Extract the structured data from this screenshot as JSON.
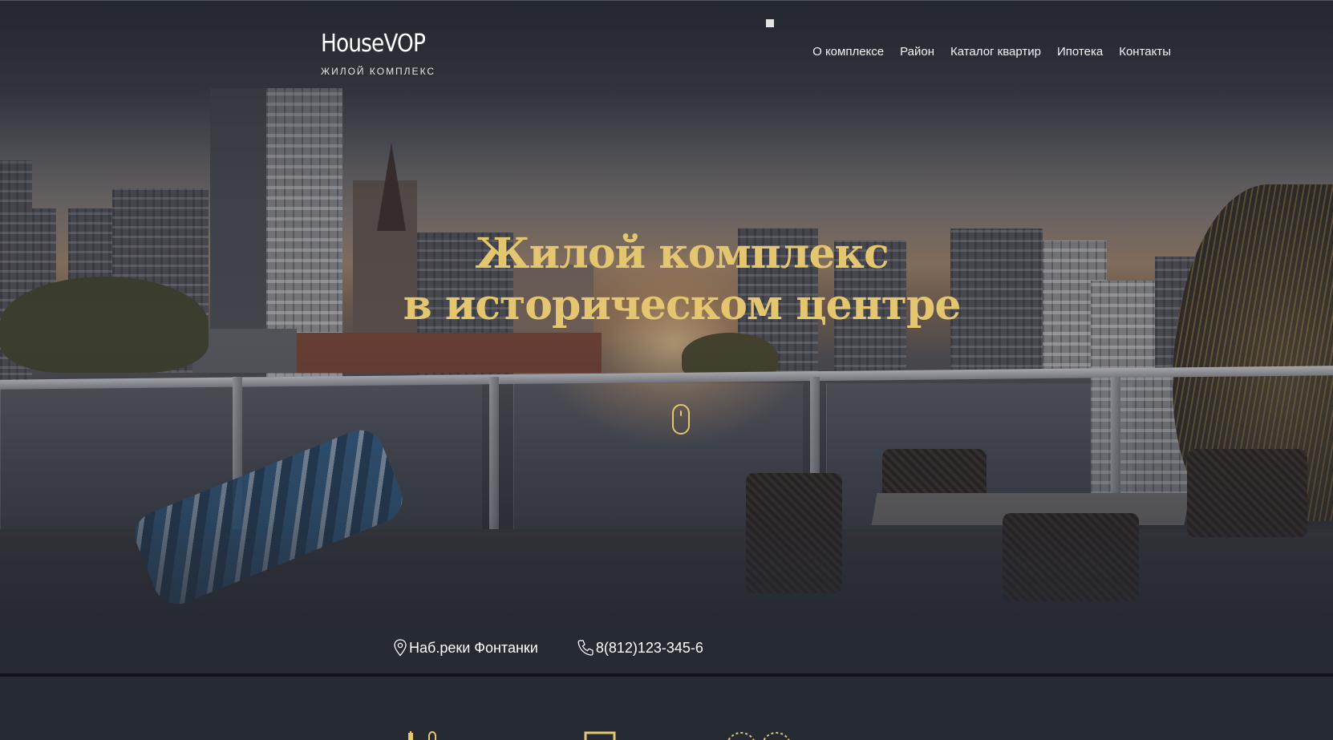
{
  "header": {
    "logo_title": "HouseVOP",
    "logo_subtitle": "ЖИЛОЙ КОМПЛЕКС",
    "nav": [
      {
        "label": "О комплексе"
      },
      {
        "label": "Район"
      },
      {
        "label": "Каталог квартир"
      },
      {
        "label": "Ипотека"
      },
      {
        "label": "Контакты"
      }
    ]
  },
  "hero": {
    "headline_line1": "Жилой комплекс",
    "headline_line2": "в историческом центре",
    "scroll_icon": "mouse-scroll-icon"
  },
  "contacts": {
    "address": "Наб.реки Фонтанки",
    "address_icon": "map-pin-icon",
    "phone": "8(812)123-345-6",
    "phone_icon": "phone-icon"
  },
  "features": {
    "icons": [
      "parking-icon",
      "monitor-icon",
      "rings-icon"
    ]
  },
  "colors": {
    "accent_gold": "#e3c66f",
    "background": "#262a33",
    "text_light": "#ffffff"
  }
}
